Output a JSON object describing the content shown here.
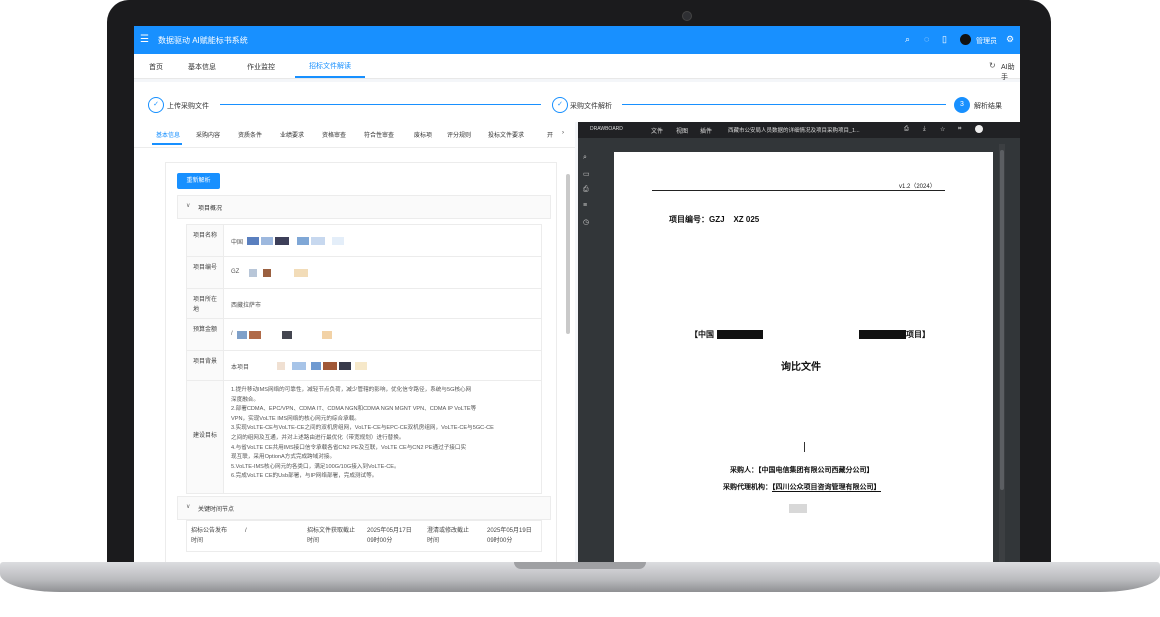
{
  "app": {
    "title": "数据驱动 AI赋能标书系统",
    "user_name": "管理员",
    "header_icons": [
      "search-icon",
      "bell-icon",
      "fullscreen-icon",
      "avatar",
      "settings-icon"
    ]
  },
  "tabs": {
    "items": [
      "首页",
      "基本信息",
      "作业监控",
      "招标文件解读"
    ],
    "active": "招标文件解读",
    "right_label": "AI助手"
  },
  "steps": [
    {
      "label": "上传采购文件",
      "state": "done",
      "mark": "✓"
    },
    {
      "label": "采购文件解析",
      "state": "done",
      "mark": "✓"
    },
    {
      "label": "解析结果",
      "state": "current",
      "mark": "3"
    }
  ],
  "subtabs": {
    "items": [
      "基本信息",
      "采购内容",
      "资质条件",
      "业绩要求",
      "资格审查",
      "符合性审查",
      "废标项",
      "评分规则",
      "投标文件要求",
      "开"
    ],
    "active": "基本信息",
    "more": "›"
  },
  "toolbar": {
    "reparse_label": "重新解析"
  },
  "project_overview": {
    "section_title": "项目概况",
    "rows": [
      {
        "label": "项目名称",
        "value": "中国"
      },
      {
        "label": "项目编号",
        "value": "GZ"
      },
      {
        "label": "项目所在地",
        "value": "西藏拉萨市"
      },
      {
        "label": "预算金额",
        "value": "/"
      },
      {
        "label": "项目背景",
        "value": "本项目"
      }
    ],
    "goals_label": "建设目标",
    "goals": [
      "1.提升移动IMS网络的可靠性，减轻节点负荷，减少管辖的影响，优化信令路径，系统与5G核心网",
      "深度融合。",
      "2.部署CDMA、EPC/VPN、CDMA IT、CDMA NGN和CDMA NGN MGNT VPN、CDMA IP VoLTE等",
      "VPN，实现VoLTE IMS网络的核心网元的综合承载。",
      "3.实现VoLTE-CE与VoLTE-CE之间的双机房组网，VoLTE-CE与EPC-CE双机房组网，VoLTE-CE与5GC-CE",
      "之间的组网及互通，并对上述路由进行最优化（带宽规划）进行替换。",
      "4.与省VoLTE CE共用IMS接口信令承载各省CN2 PE及互联，VoLTE CE与CN2 PE通过子接口实",
      "现互联，采用OptionA方式完成跨域对接。",
      "5.VoLTE-IMS核心网元的各类口，满足100G/10G接入到VoLTE-CE。",
      "6.完成VoLTE CE的Usb部署，与IP网络部署，完成测试等。"
    ]
  },
  "key_timeline": {
    "section_title": "关键时间节点",
    "cells": [
      "招标公告发布时间",
      "/",
      "招标文件获取截止时间",
      "2025年05月17日09时00分",
      "澄清或修改截止时间",
      "2025年05月19日09时00分"
    ]
  },
  "pdf_viewer": {
    "toolbar_items": [
      "文件",
      "视图",
      "插件",
      "西藏市公安局人员数据的详细情况及项目采购项目_1..."
    ],
    "brand": "DRAWBOARD",
    "page": {
      "version": "v1.2（2024）",
      "project_no_label": "项目编号：GZJ",
      "project_no_rest": "XZ      025",
      "project_title_prefix": "【中国",
      "project_title_suffix": "项目】",
      "doc_type": "询比文件",
      "buyer": "采购人：【中国电信集团有限公司西藏分公司】",
      "agent_prefix": "采购代理机构：",
      "agent_name": "【四川公众项目咨询管理有限公司】"
    }
  },
  "colors": {
    "primary": "#1890ff",
    "bezel": "#1b1b1d",
    "pdf_bg": "#323639"
  }
}
